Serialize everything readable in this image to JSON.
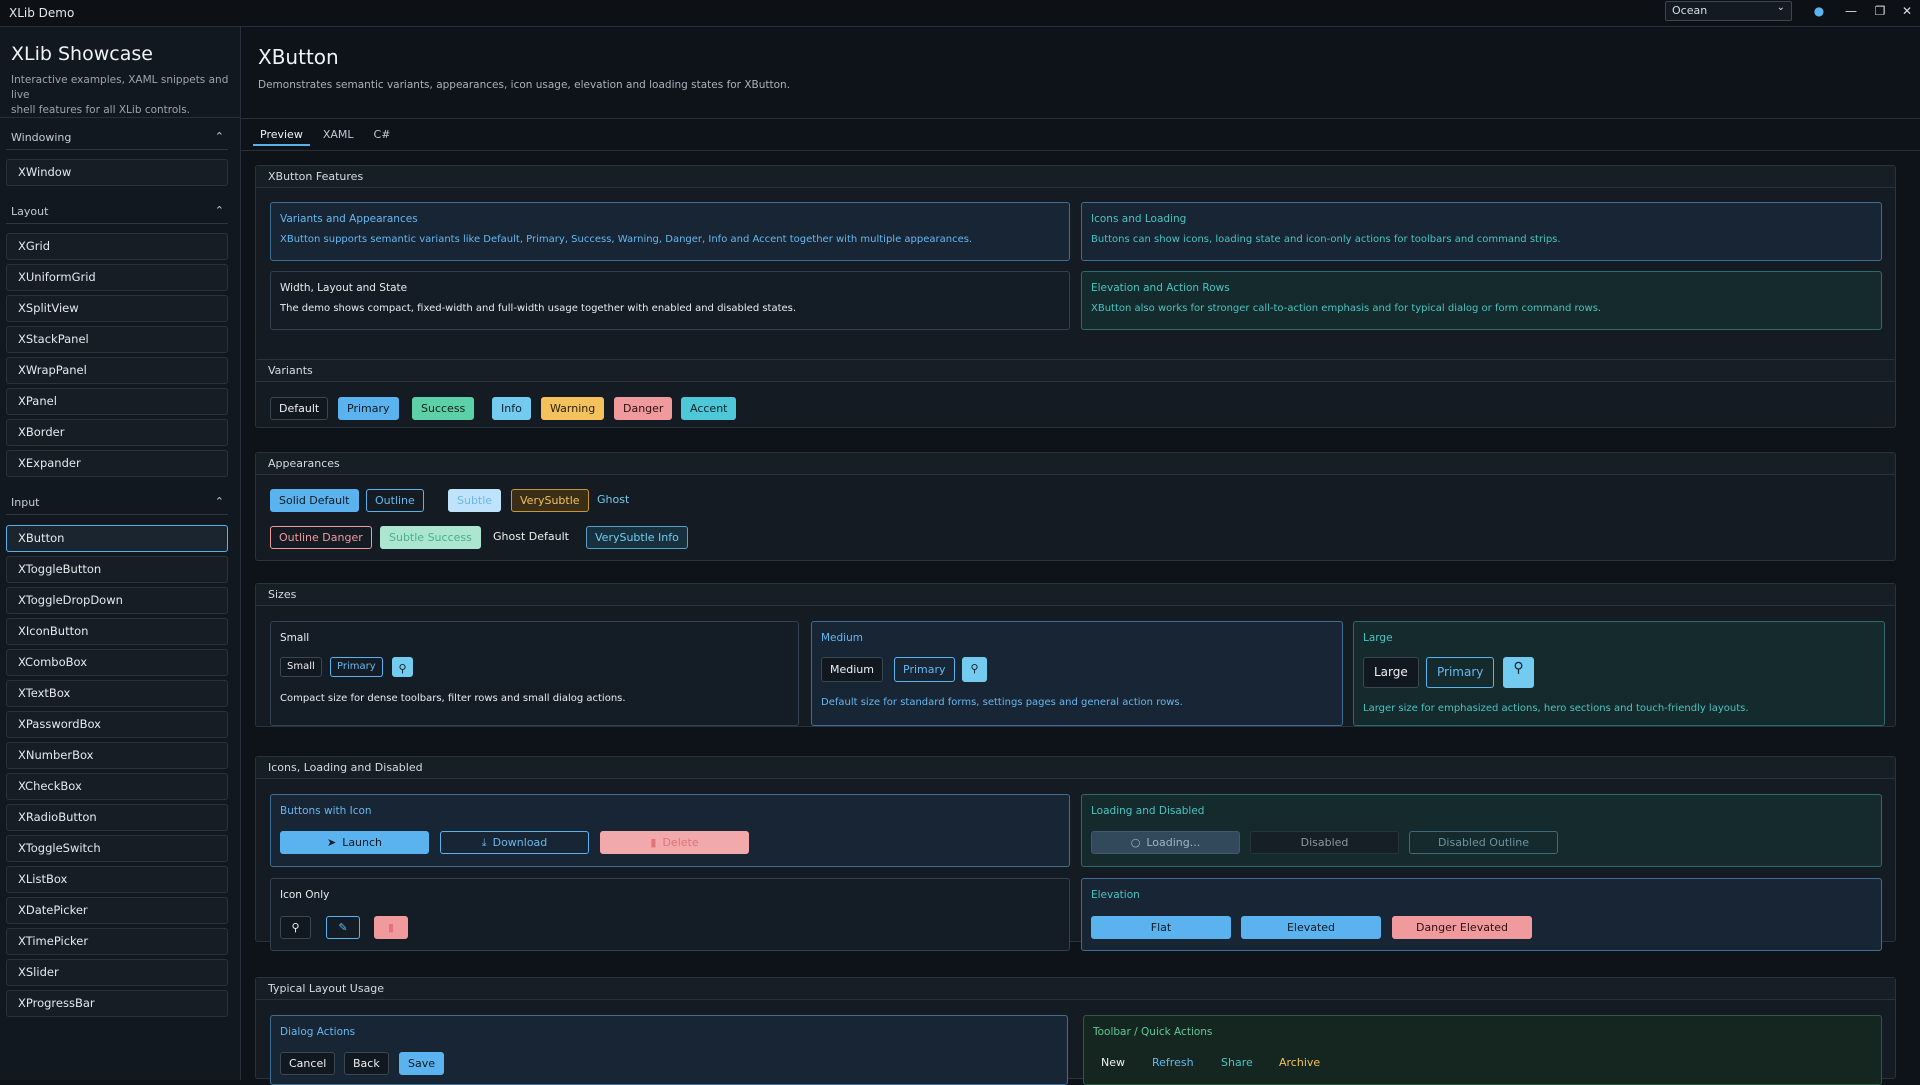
{
  "titlebar": {
    "title": "XLib Demo",
    "theme": "Ocean"
  },
  "sidebar": {
    "title": "XLib Showcase",
    "description_line1": "Interactive examples, XAML snippets and live",
    "description_line2": "shell features for all XLib controls.",
    "groups": [
      {
        "label": "Windowing",
        "items": [
          "XWindow"
        ]
      },
      {
        "label": "Layout",
        "items": [
          "XGrid",
          "XUniformGrid",
          "XSplitView",
          "XStackPanel",
          "XWrapPanel",
          "XPanel",
          "XBorder",
          "XExpander"
        ]
      },
      {
        "label": "Input",
        "items": [
          "XButton",
          "XToggleButton",
          "XToggleDropDown",
          "XIconButton",
          "XComboBox",
          "XTextBox",
          "XPasswordBox",
          "XNumberBox",
          "XCheckBox",
          "XRadioButton",
          "XToggleSwitch",
          "XListBox",
          "XDatePicker",
          "XTimePicker",
          "XSlider",
          "XProgressBar"
        ]
      }
    ],
    "selected": "XButton"
  },
  "page": {
    "title": "XButton",
    "description": "Demonstrates semantic variants, appearances, icon usage, elevation and loading states for XButton.",
    "tabs": [
      "Preview",
      "XAML",
      "C#"
    ]
  },
  "features": {
    "header": "XButton Features",
    "cards": [
      {
        "title": "Variants and Appearances",
        "text": "XButton supports semantic variants like Default, Primary, Success, Warning, Danger, Info and Accent together with multiple appearances."
      },
      {
        "title": "Icons and Loading",
        "text": "Buttons can show icons, loading state and icon-only actions for toolbars and command strips."
      },
      {
        "title": "Width, Layout and State",
        "text": "The demo shows compact, fixed-width and full-width usage together with enabled and disabled states."
      },
      {
        "title": "Elevation and Action Rows",
        "text": "XButton also works for stronger call-to-action emphasis and for typical dialog or form command rows."
      }
    ]
  },
  "variants": {
    "header": "Variants",
    "buttons": [
      "Default",
      "Primary",
      "Success",
      "Info",
      "Warning",
      "Danger",
      "Accent"
    ]
  },
  "appearances": {
    "header": "Appearances",
    "row1": [
      "Solid Default",
      "Outline",
      "Subtle",
      "VerySubtle",
      "Ghost"
    ],
    "row2": [
      "Outline Danger",
      "Subtle Success",
      "Ghost Default",
      "VerySubtle Info"
    ]
  },
  "sizes": {
    "header": "Sizes",
    "small": {
      "title": "Small",
      "btn1": "Small",
      "btn2": "Primary",
      "text": "Compact size for dense toolbars, filter rows and small dialog actions."
    },
    "medium": {
      "title": "Medium",
      "btn1": "Medium",
      "btn2": "Primary",
      "text": "Default size for standard forms, settings pages and general action rows."
    },
    "large": {
      "title": "Large",
      "btn1": "Large",
      "btn2": "Primary",
      "text": "Larger size for emphasized actions, hero sections and touch-friendly layouts."
    }
  },
  "icons": {
    "header": "Icons, Loading and Disabled",
    "with_icon": {
      "title": "Buttons with Icon",
      "launch": "Launch",
      "download": "Download",
      "delete": "Delete"
    },
    "loading": {
      "title": "Loading and Disabled",
      "loading": "Loading...",
      "disabled": "Disabled",
      "disabled_outline": "Disabled Outline"
    },
    "icon_only": {
      "title": "Icon Only"
    },
    "elevation": {
      "title": "Elevation",
      "flat": "Flat",
      "elevated": "Elevated",
      "danger_elevated": "Danger Elevated"
    }
  },
  "typical": {
    "header": "Typical Layout Usage",
    "dialog": {
      "title": "Dialog Actions",
      "cancel": "Cancel",
      "back": "Back",
      "save": "Save"
    },
    "toolbar": {
      "title": "Toolbar / Quick Actions",
      "new": "New",
      "refresh": "Refresh",
      "share": "Share",
      "archive": "Archive"
    }
  }
}
